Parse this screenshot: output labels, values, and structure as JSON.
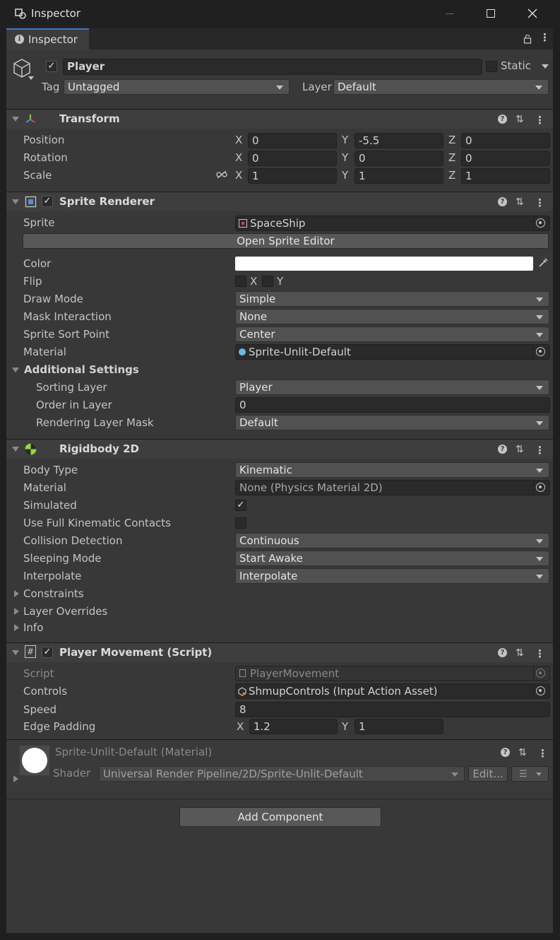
{
  "window": {
    "title": "Inspector"
  },
  "tab": {
    "label": "Inspector"
  },
  "gameobject": {
    "name": "Player",
    "static_label": "Static",
    "tag_label": "Tag",
    "tag_value": "Untagged",
    "layer_label": "Layer",
    "layer_value": "Default"
  },
  "transform": {
    "title": "Transform",
    "rows": [
      {
        "label": "Position",
        "x": "0",
        "y": "-5.5",
        "z": "0"
      },
      {
        "label": "Rotation",
        "x": "0",
        "y": "0",
        "z": "0"
      },
      {
        "label": "Scale",
        "x": "1",
        "y": "1",
        "z": "1"
      }
    ],
    "axis": {
      "x": "X",
      "y": "Y",
      "z": "Z"
    }
  },
  "sprite_renderer": {
    "title": "Sprite Renderer",
    "sprite_label": "Sprite",
    "sprite_value": "SpaceShip",
    "open_editor": "Open Sprite Editor",
    "color_label": "Color",
    "color_value": "#ffffff",
    "flip_label": "Flip",
    "flip_x": "X",
    "flip_y": "Y",
    "draw_mode_label": "Draw Mode",
    "draw_mode_value": "Simple",
    "mask_label": "Mask Interaction",
    "mask_value": "None",
    "sort_point_label": "Sprite Sort Point",
    "sort_point_value": "Center",
    "material_label": "Material",
    "material_value": "Sprite-Unlit-Default",
    "additional_label": "Additional Settings",
    "sorting_layer_label": "Sorting Layer",
    "sorting_layer_value": "Player",
    "order_label": "Order in Layer",
    "order_value": "0",
    "rendering_mask_label": "Rendering Layer Mask",
    "rendering_mask_value": "Default"
  },
  "rigidbody": {
    "title": "Rigidbody 2D",
    "body_type_label": "Body Type",
    "body_type_value": "Kinematic",
    "material_label": "Material",
    "material_value": "None (Physics Material 2D)",
    "simulated_label": "Simulated",
    "full_contacts_label": "Use Full Kinematic Contacts",
    "collision_label": "Collision Detection",
    "collision_value": "Continuous",
    "sleeping_label": "Sleeping Mode",
    "sleeping_value": "Start Awake",
    "interpolate_label": "Interpolate",
    "interpolate_value": "Interpolate",
    "constraints_label": "Constraints",
    "layer_overrides_label": "Layer Overrides",
    "info_label": "Info"
  },
  "player_movement": {
    "title": "Player Movement (Script)",
    "script_label": "Script",
    "script_value": "PlayerMovement",
    "controls_label": "Controls",
    "controls_value": "ShmupControls (Input Action Asset)",
    "speed_label": "Speed",
    "speed_value": "8",
    "edge_label": "Edge Padding",
    "edge_x": "1.2",
    "edge_y": "1",
    "axis_x": "X",
    "axis_y": "Y"
  },
  "material_preview": {
    "name": "Sprite-Unlit-Default (Material)",
    "shader_label": "Shader",
    "shader_value": "Universal Render Pipeline/2D/Sprite-Unlit-Default",
    "edit_label": "Edit..."
  },
  "add_component": "Add Component",
  "colors": {
    "accent": "#3a79bb",
    "panel": "#383838",
    "header": "#3e3e3e"
  }
}
